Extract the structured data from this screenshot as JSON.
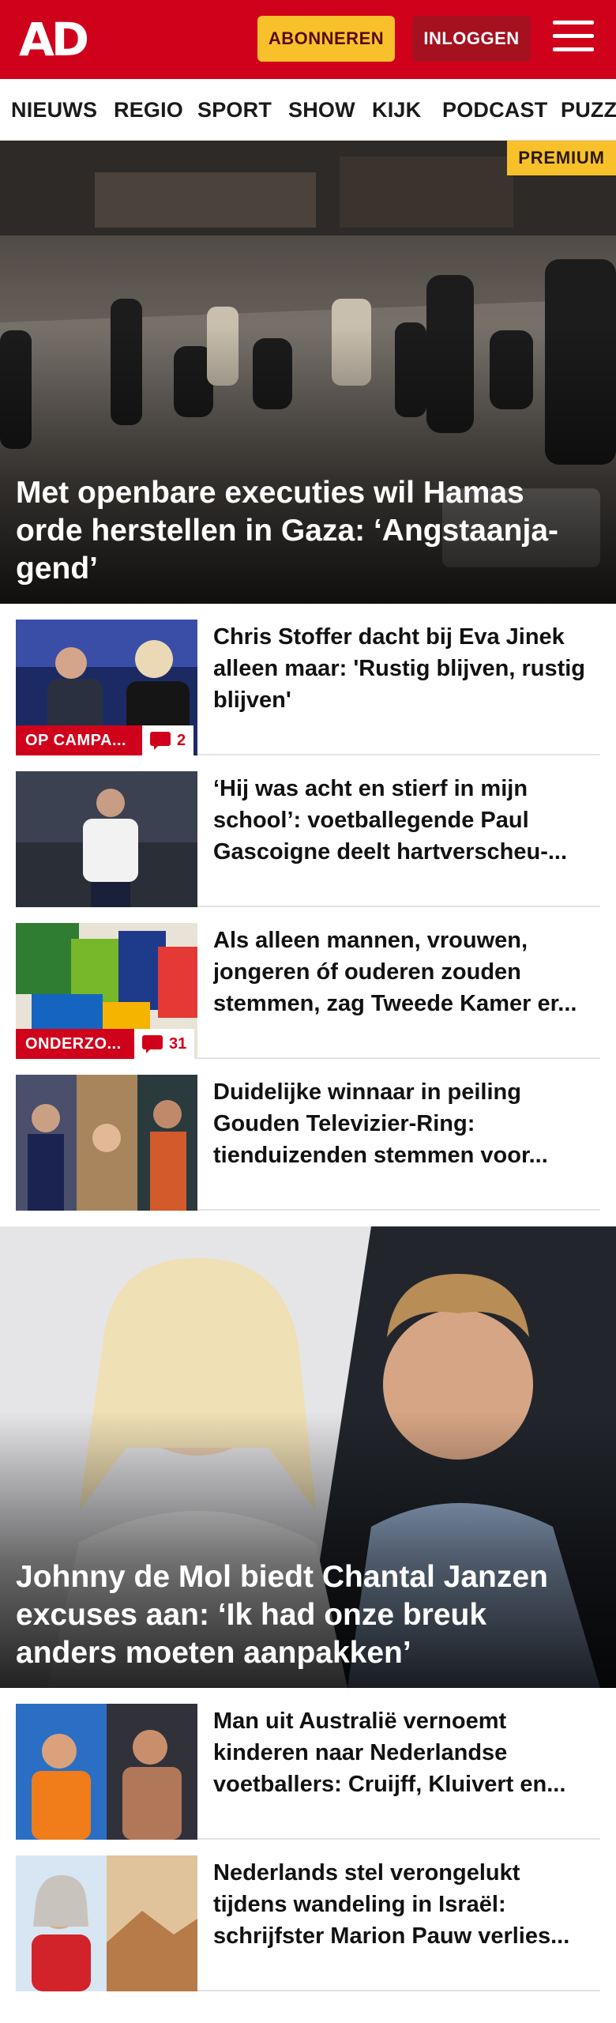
{
  "header": {
    "logo": "AD",
    "subscribe_label": "ABONNEREN",
    "login_label": "INLOGGEN"
  },
  "nav": {
    "items": [
      "NIEUWS",
      "REGIO",
      "SPORT",
      "SHOW",
      "KIJK",
      "PODCAST",
      "PUZZ"
    ]
  },
  "hero_1": {
    "badge": "PREMIUM",
    "title": "Met openbare executies wil Hamas orde herstellen in Gaza: ‘Angstaanja-gend’"
  },
  "articles_1": [
    {
      "title": "Chris Stoffer dacht bij Eva Jinek alleen maar: 'Rustig blijven, rustig blijven'",
      "tag": "OP CAMPA...",
      "comments": "2"
    },
    {
      "title": "‘Hij was acht en stierf in mijn school’: voetballegende Paul Gascoigne deelt hartverscheu-..."
    },
    {
      "title": "Als alleen mannen, vrouwen, jongeren óf ouderen zouden stemmen, zag Tweede Kamer er...",
      "tag": "ONDERZO...",
      "comments": "31"
    },
    {
      "title": "Duidelijke winnaar in peiling Gouden Televizier-Ring: tienduizenden stemmen voor..."
    }
  ],
  "hero_2": {
    "title": "Johnny de Mol biedt Chantal Janzen excuses aan: ‘Ik had onze breuk anders moeten aanpakken’"
  },
  "articles_2": [
    {
      "title": "Man uit Australië vernoemt kinderen naar Nederlandse voetballers: Cruijff, Kluivert en..."
    },
    {
      "title": "Nederlands stel verongelukt tijdens wandeling in Israël: schrijfster Marion Pauw verlies..."
    }
  ],
  "colors": {
    "brand_red": "#d0021b",
    "accent_yellow": "#f8c12b",
    "login_red": "#a5111f"
  },
  "icons": [
    "hamburger-menu-icon",
    "comment-icon"
  ]
}
